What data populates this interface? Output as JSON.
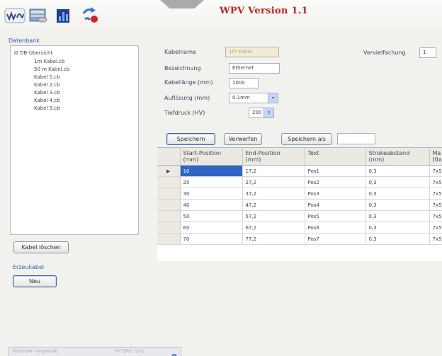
{
  "window": {
    "title": "WPV Version 1.1"
  },
  "toolbar": {
    "icons": [
      "wave-logo-icon",
      "database-icon",
      "chart-icon",
      "sync-icon"
    ]
  },
  "db_panel": {
    "group_label": "Datenbank",
    "tree_root": "DB-Übersicht",
    "tree_items": [
      "1m Kabel.cb",
      "50 m Kabel.cb",
      "Kabel 1.cb",
      "Kabel 2.cb",
      "Kabel 3.cb",
      "Kabel 4.cb",
      "Kabel 5.cb"
    ],
    "delete_button": "Kabel löschen"
  },
  "create_panel": {
    "group_label": "Erzeukabel",
    "new_button": "Neu"
  },
  "form": {
    "cable_name_label": "Kabelname",
    "cable_name_value": "1m Kabel",
    "description_label": "Bezeichnung",
    "description_value": "Ethernet",
    "length_label": "Kabellänge (mm)",
    "length_value": "1000",
    "resolution_label": "Auflösung (mm)",
    "resolution_value": "0.1mm",
    "resolution_arrow": "▾",
    "depth_label": "Tiefdruck (HV)",
    "depth_value": "200",
    "depth_arrow": "⇕",
    "multiply_label": "Vervielfachung",
    "multiply_value": "1"
  },
  "actions": {
    "save": "Speichern",
    "discard": "Verwerfen",
    "save_as": "Speichern als",
    "save_as_value": ""
  },
  "grid": {
    "columns": [
      {
        "label": "Start-Position",
        "sub": "(mm)"
      },
      {
        "label": "End-Position",
        "sub": "(mm)"
      },
      {
        "label": "Text",
        "sub": ""
      },
      {
        "label": "Strokeabstand",
        "sub": "(mm)"
      },
      {
        "label": "Ma",
        "sub": "(0x"
      }
    ],
    "rows": [
      {
        "marker": "▶",
        "start": "10",
        "end": "17,2",
        "text": "Pos1",
        "stroke": "0,3",
        "ma": "7x5"
      },
      {
        "marker": "",
        "start": "20",
        "end": "27,2",
        "text": "Pos2",
        "stroke": "0,3",
        "ma": "7x5"
      },
      {
        "marker": "",
        "start": "30",
        "end": "37,2",
        "text": "Pos3",
        "stroke": "0,3",
        "ma": "7x5"
      },
      {
        "marker": "",
        "start": "40",
        "end": "47,2",
        "text": "Pos4",
        "stroke": "0,3",
        "ma": "7x5"
      },
      {
        "marker": "",
        "start": "50",
        "end": "57,2",
        "text": "Pos5",
        "stroke": "0,3",
        "ma": "7x5"
      },
      {
        "marker": "",
        "start": "60",
        "end": "67,2",
        "text": "Pos6",
        "stroke": "0,3",
        "ma": "7x5"
      },
      {
        "marker": "",
        "start": "70",
        "end": "77,2",
        "text": "Pos7",
        "stroke": "0,3",
        "ma": "7x5"
      }
    ]
  },
  "status": {
    "left_text": "Verbinden hergestellt",
    "right_text": "KETERE: 1/01",
    "icon": "connection-icon"
  }
}
